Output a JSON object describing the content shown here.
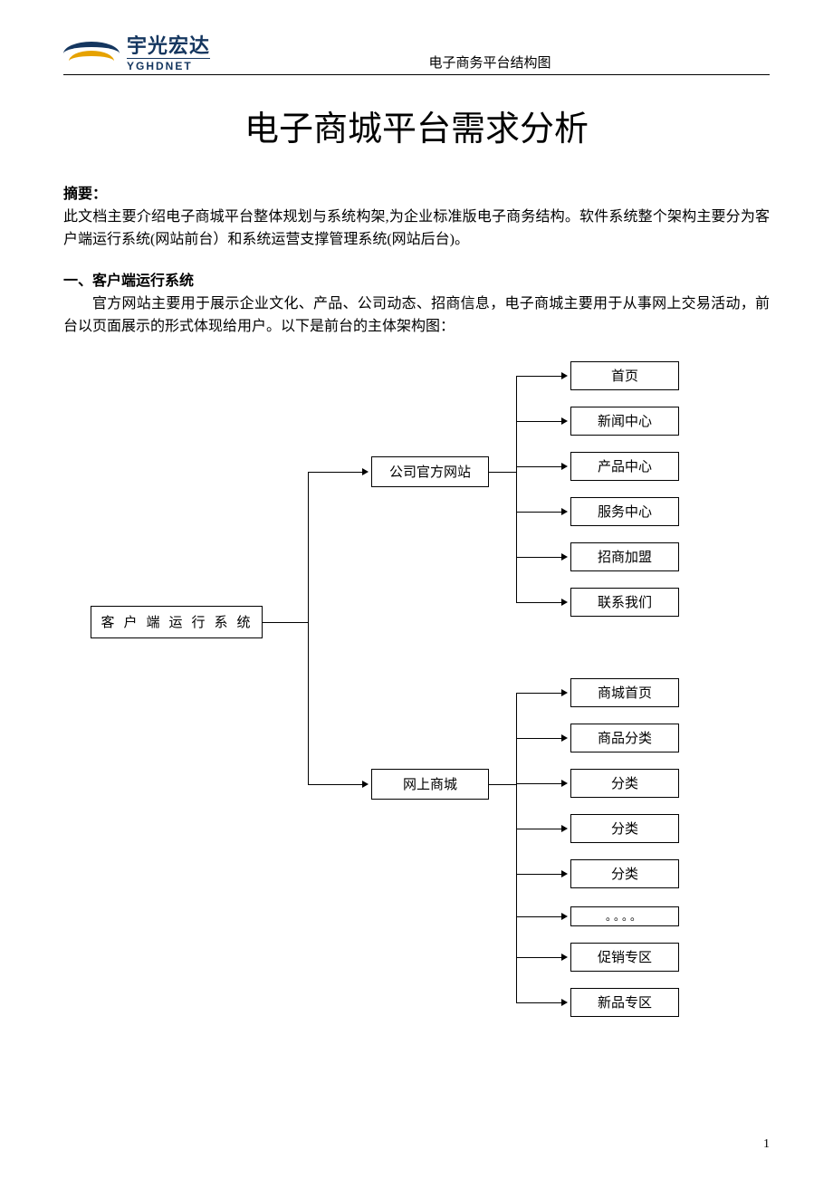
{
  "header": {
    "logo_cn": "宇光宏达",
    "logo_en": "YGHDNET",
    "caption": "电子商务平台结构图"
  },
  "title": "电子商城平台需求分析",
  "abstract": {
    "label": "摘要：",
    "text": "此文档主要介绍电子商城平台整体规划与系统构架,为企业标准版电子商务结构。软件系统整个架构主要分为客户端运行系统(网站前台）和系统运营支撑管理系统(网站后台)。"
  },
  "section1": {
    "heading": "一、客户端运行系统",
    "text": "官方网站主要用于展示企业文化、产品、公司动态、招商信息，电子商城主要用于从事网上交易活动，前台以页面展示的形式体现给用户。以下是前台的主体架构图："
  },
  "diagram": {
    "root": "客户端运行系统",
    "mid": [
      "公司官方网站",
      "网上商城"
    ],
    "leaves_top": [
      "首页",
      "新闻中心",
      "产品中心",
      "服务中心",
      "招商加盟",
      "联系我们"
    ],
    "leaves_bot": [
      "商城首页",
      "商品分类",
      "分类",
      "分类",
      "分类",
      "。。。。",
      "促销专区",
      "新品专区"
    ]
  },
  "page_number": "1"
}
